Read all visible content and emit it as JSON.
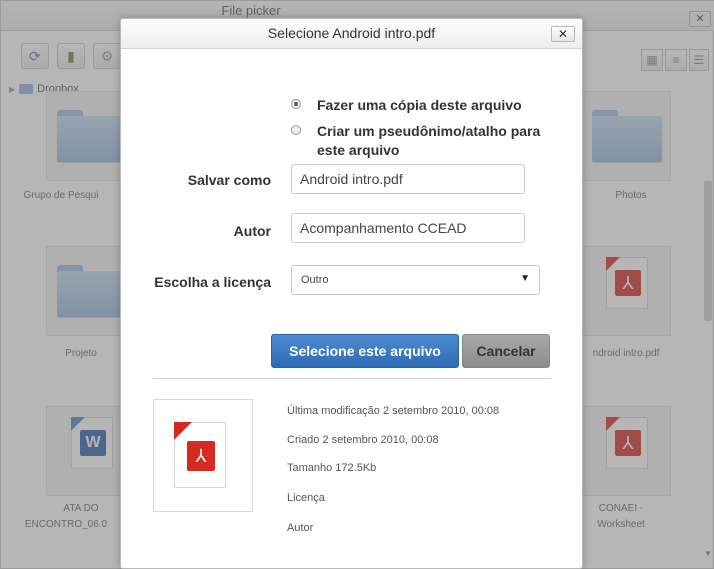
{
  "picker": {
    "title": "File picker",
    "close_glyph": "✕",
    "toolbar": [
      {
        "name": "refresh-icon",
        "glyph": "⟳"
      },
      {
        "name": "download-icon",
        "glyph": "▮"
      },
      {
        "name": "settings-icon",
        "glyph": "⚙"
      }
    ],
    "breadcrumb": "Dropbox",
    "files": [
      {
        "label": "Grupo de Pesqui",
        "type": "folder"
      },
      {
        "label": "Photos",
        "type": "folder"
      },
      {
        "label": "Projeto",
        "type": "folder"
      },
      {
        "label": "ndroid intro.pdf",
        "type": "pdf"
      },
      {
        "label_line1": "ATA DO",
        "label_line2": "ENCONTRO_06.0",
        "type": "word"
      },
      {
        "label_line1": "CONAEI -",
        "label_line2": "Worksheet",
        "type": "pdf"
      }
    ]
  },
  "dialog": {
    "title": "Selecione Android intro.pdf",
    "close_glyph": "✕",
    "option_copy": "Fazer uma cópia deste arquivo",
    "option_alias": "Criar um pseudônimo/atalho para este arquivo",
    "save_as_label": "Salvar como",
    "save_as_value": "Android intro.pdf",
    "author_label": "Autor",
    "author_value": "Acompanhamento CCEAD",
    "license_label": "Escolha a licença",
    "license_value": "Outro",
    "select_button": "Selecione este arquivo",
    "cancel_button": "Cancelar",
    "info": {
      "modified": "Última modificação 2 setembro 2010, 00:08",
      "created": "Criado 2 setembro 2010, 00:08",
      "size": "Tamanho 172.5Kb",
      "license": "Licença",
      "author": "Autor"
    }
  }
}
